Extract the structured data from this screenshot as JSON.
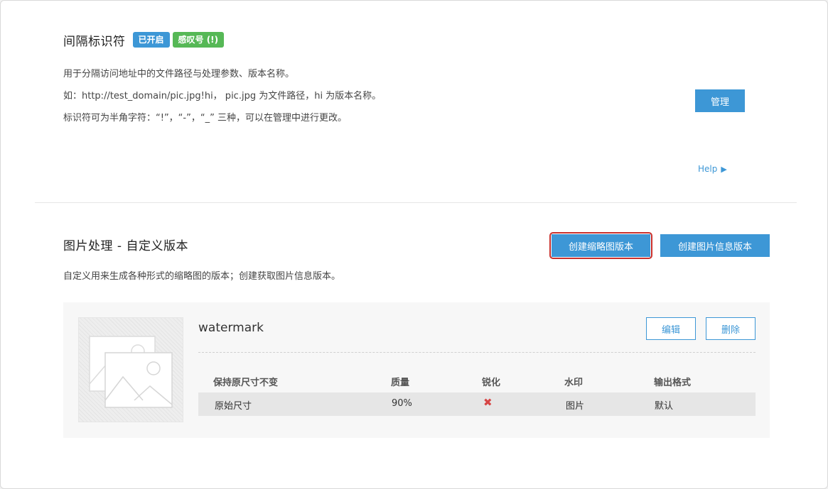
{
  "separator_section": {
    "title": "间隔标识符",
    "badge_status": "已开启",
    "badge_type": "感叹号 (!)",
    "desc_1": "用于分隔访问地址中的文件路径与处理参数、版本名称。",
    "desc_2": "如：http://test_domain/pic.jpg!hi，  pic.jpg 为文件路径，hi 为版本名称。",
    "desc_3": "标识符可为半角字符：“!”，“-”，“_” 三种，可以在管理中进行更改。",
    "manage_label": "管理",
    "help_label": "Help"
  },
  "version_section": {
    "title": "图片处理 - 自定义版本",
    "desc": "自定义用来生成各种形式的缩略图的版本；创建获取图片信息版本。",
    "create_thumb_label": "创建缩略图版本",
    "create_info_label": "创建图片信息版本"
  },
  "version_card": {
    "name": "watermark",
    "edit_label": "编辑",
    "delete_label": "删除",
    "columns": [
      "保持原尺寸不变",
      "质量",
      "锐化",
      "水印",
      "输出格式"
    ],
    "row": {
      "size": "原始尺寸",
      "quality": "90%",
      "sharpen": "✖",
      "watermark": "图片",
      "format": "默认"
    }
  },
  "colors": {
    "accent": "#3d97d6",
    "badge_green": "#56b856",
    "danger": "#d64545",
    "focus_ring": "#c9302c"
  },
  "icons": {
    "help_arrow": "triangle-right-icon",
    "thumbnail": "image-placeholder-icon",
    "sharpen": "cross-mark-icon"
  }
}
